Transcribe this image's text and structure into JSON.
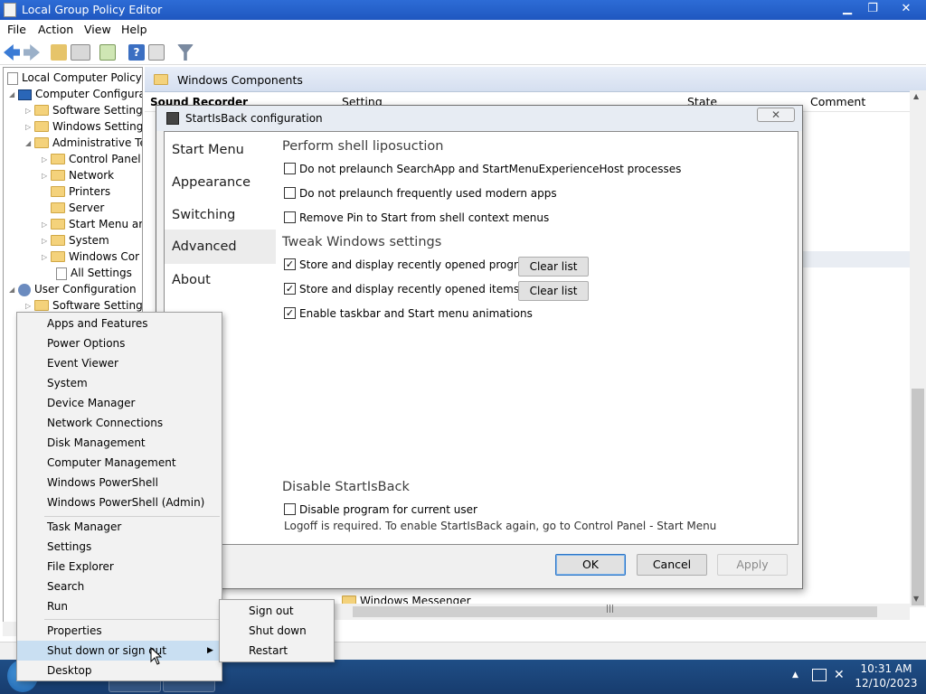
{
  "window": {
    "title": "Local Group Policy Editor",
    "min": "▁",
    "max": "❐",
    "close": "✕"
  },
  "menu": [
    "File",
    "Action",
    "View",
    "Help"
  ],
  "tree": [
    {
      "label": "Local Computer Policy"
    },
    {
      "label": "Computer Configura"
    },
    {
      "label": "Software Settings"
    },
    {
      "label": "Windows Setting"
    },
    {
      "label": "Administrative Te"
    },
    {
      "label": "Control Panel"
    },
    {
      "label": "Network"
    },
    {
      "label": "Printers"
    },
    {
      "label": "Server"
    },
    {
      "label": "Start Menu ar"
    },
    {
      "label": "System"
    },
    {
      "label": "Windows Cor"
    },
    {
      "label": "All Settings"
    },
    {
      "label": "User Configuration"
    },
    {
      "label": "Software Settings"
    }
  ],
  "right": {
    "header": "Windows Components",
    "left_col": "Sound Recorder",
    "col_setting": "Setting",
    "col_state": "State",
    "col_comment": "Comment",
    "messenger": "Windows Messenger"
  },
  "dialog": {
    "title": "StartIsBack configuration",
    "close": "✕",
    "nav": [
      "Start Menu",
      "Appearance",
      "Switching",
      "Advanced",
      "About"
    ],
    "sections": {
      "liposuction": "Perform shell liposuction",
      "tweak": "Tweak Windows settings",
      "disable": "Disable StartIsBack"
    },
    "checks": {
      "no_prelaunch_search": "Do not prelaunch SearchApp and StartMenuExperienceHost processes",
      "no_prelaunch_modern": "Do not prelaunch frequently used modern apps",
      "remove_pin": "Remove Pin to Start from shell context menus",
      "recent_programs": "Store and display recently opened programs",
      "recent_items": "Store and display recently opened items",
      "animations": "Enable taskbar and Start menu animations",
      "disable_program": "Disable program for current user"
    },
    "check_mark": "✓",
    "clear_list": "Clear list",
    "note": "Logoff is required. To enable StartIsBack again, go to Control Panel - Start Menu",
    "buttons": {
      "ok": "OK",
      "cancel": "Cancel",
      "apply": "Apply"
    }
  },
  "context_menu": {
    "group1": [
      "Apps and Features",
      "Power Options",
      "Event Viewer",
      "System",
      "Device Manager",
      "Network Connections",
      "Disk Management",
      "Computer Management",
      "Windows PowerShell",
      "Windows PowerShell (Admin)"
    ],
    "group2": [
      "Task Manager",
      "Settings",
      "File Explorer",
      "Search",
      "Run"
    ],
    "group3": [
      "Properties",
      "Shut down or sign out",
      "Desktop"
    ],
    "arrow": "▶"
  },
  "submenu": [
    "Sign out",
    "Shut down",
    "Restart"
  ],
  "clock": {
    "time": "10:31 AM",
    "date": "12/10/2023"
  }
}
